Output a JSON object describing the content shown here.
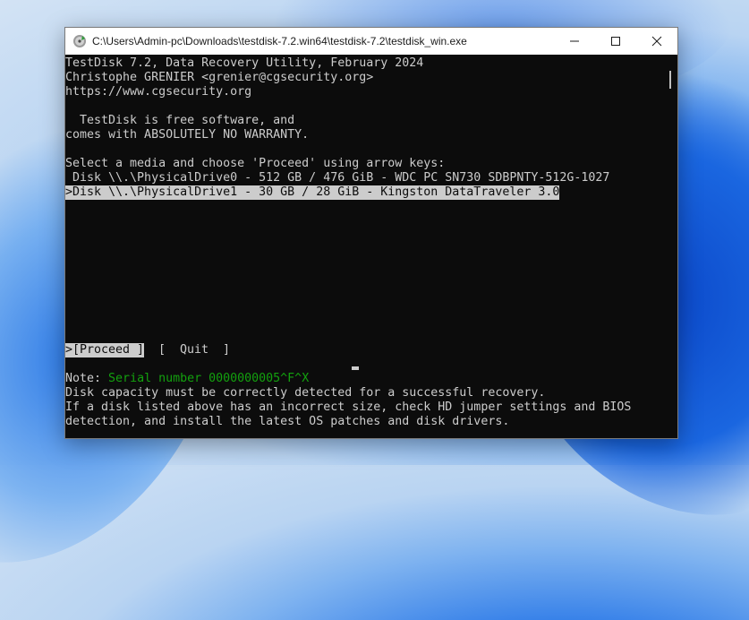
{
  "window": {
    "title": "C:\\Users\\Admin-pc\\Downloads\\testdisk-7.2.win64\\testdisk-7.2\\testdisk_win.exe",
    "icon": "testdisk-app-icon",
    "controls": {
      "minimize": "minimize-icon",
      "maximize": "maximize-icon",
      "close": "close-icon"
    }
  },
  "console": {
    "header": [
      "TestDisk 7.2, Data Recovery Utility, February 2024",
      "Christophe GRENIER <grenier@cgsecurity.org>",
      "https://www.cgsecurity.org"
    ],
    "license": [
      "  TestDisk is free software, and",
      "comes with ABSOLUTELY NO WARRANTY."
    ],
    "prompt": "Select a media and choose 'Proceed' using arrow keys:",
    "drives": [
      {
        "text": " Disk \\\\.\\PhysicalDrive0 - 512 GB / 476 GiB - WDC PC SN730 SDBPNTY-512G-1027",
        "selected": false
      },
      {
        "text": ">Disk \\\\.\\PhysicalDrive1 - 30 GB / 28 GiB - Kingston DataTraveler 3.0",
        "selected": true
      }
    ],
    "menu": {
      "proceed": ">[Proceed ]",
      "quit": "[  Quit  ]"
    },
    "note_label": "Note: ",
    "note_value": "Serial number 0000000005^F^X",
    "footer": [
      "Disk capacity must be correctly detected for a successful recovery.",
      "If a disk listed above has an incorrect size, check HD jumper settings and BIOS",
      "detection, and install the latest OS patches and disk drivers."
    ]
  },
  "colors": {
    "console_bg": "#0c0c0c",
    "console_fg": "#cccccc",
    "highlight_bg": "#cccccc",
    "note_green": "#13a10e"
  }
}
